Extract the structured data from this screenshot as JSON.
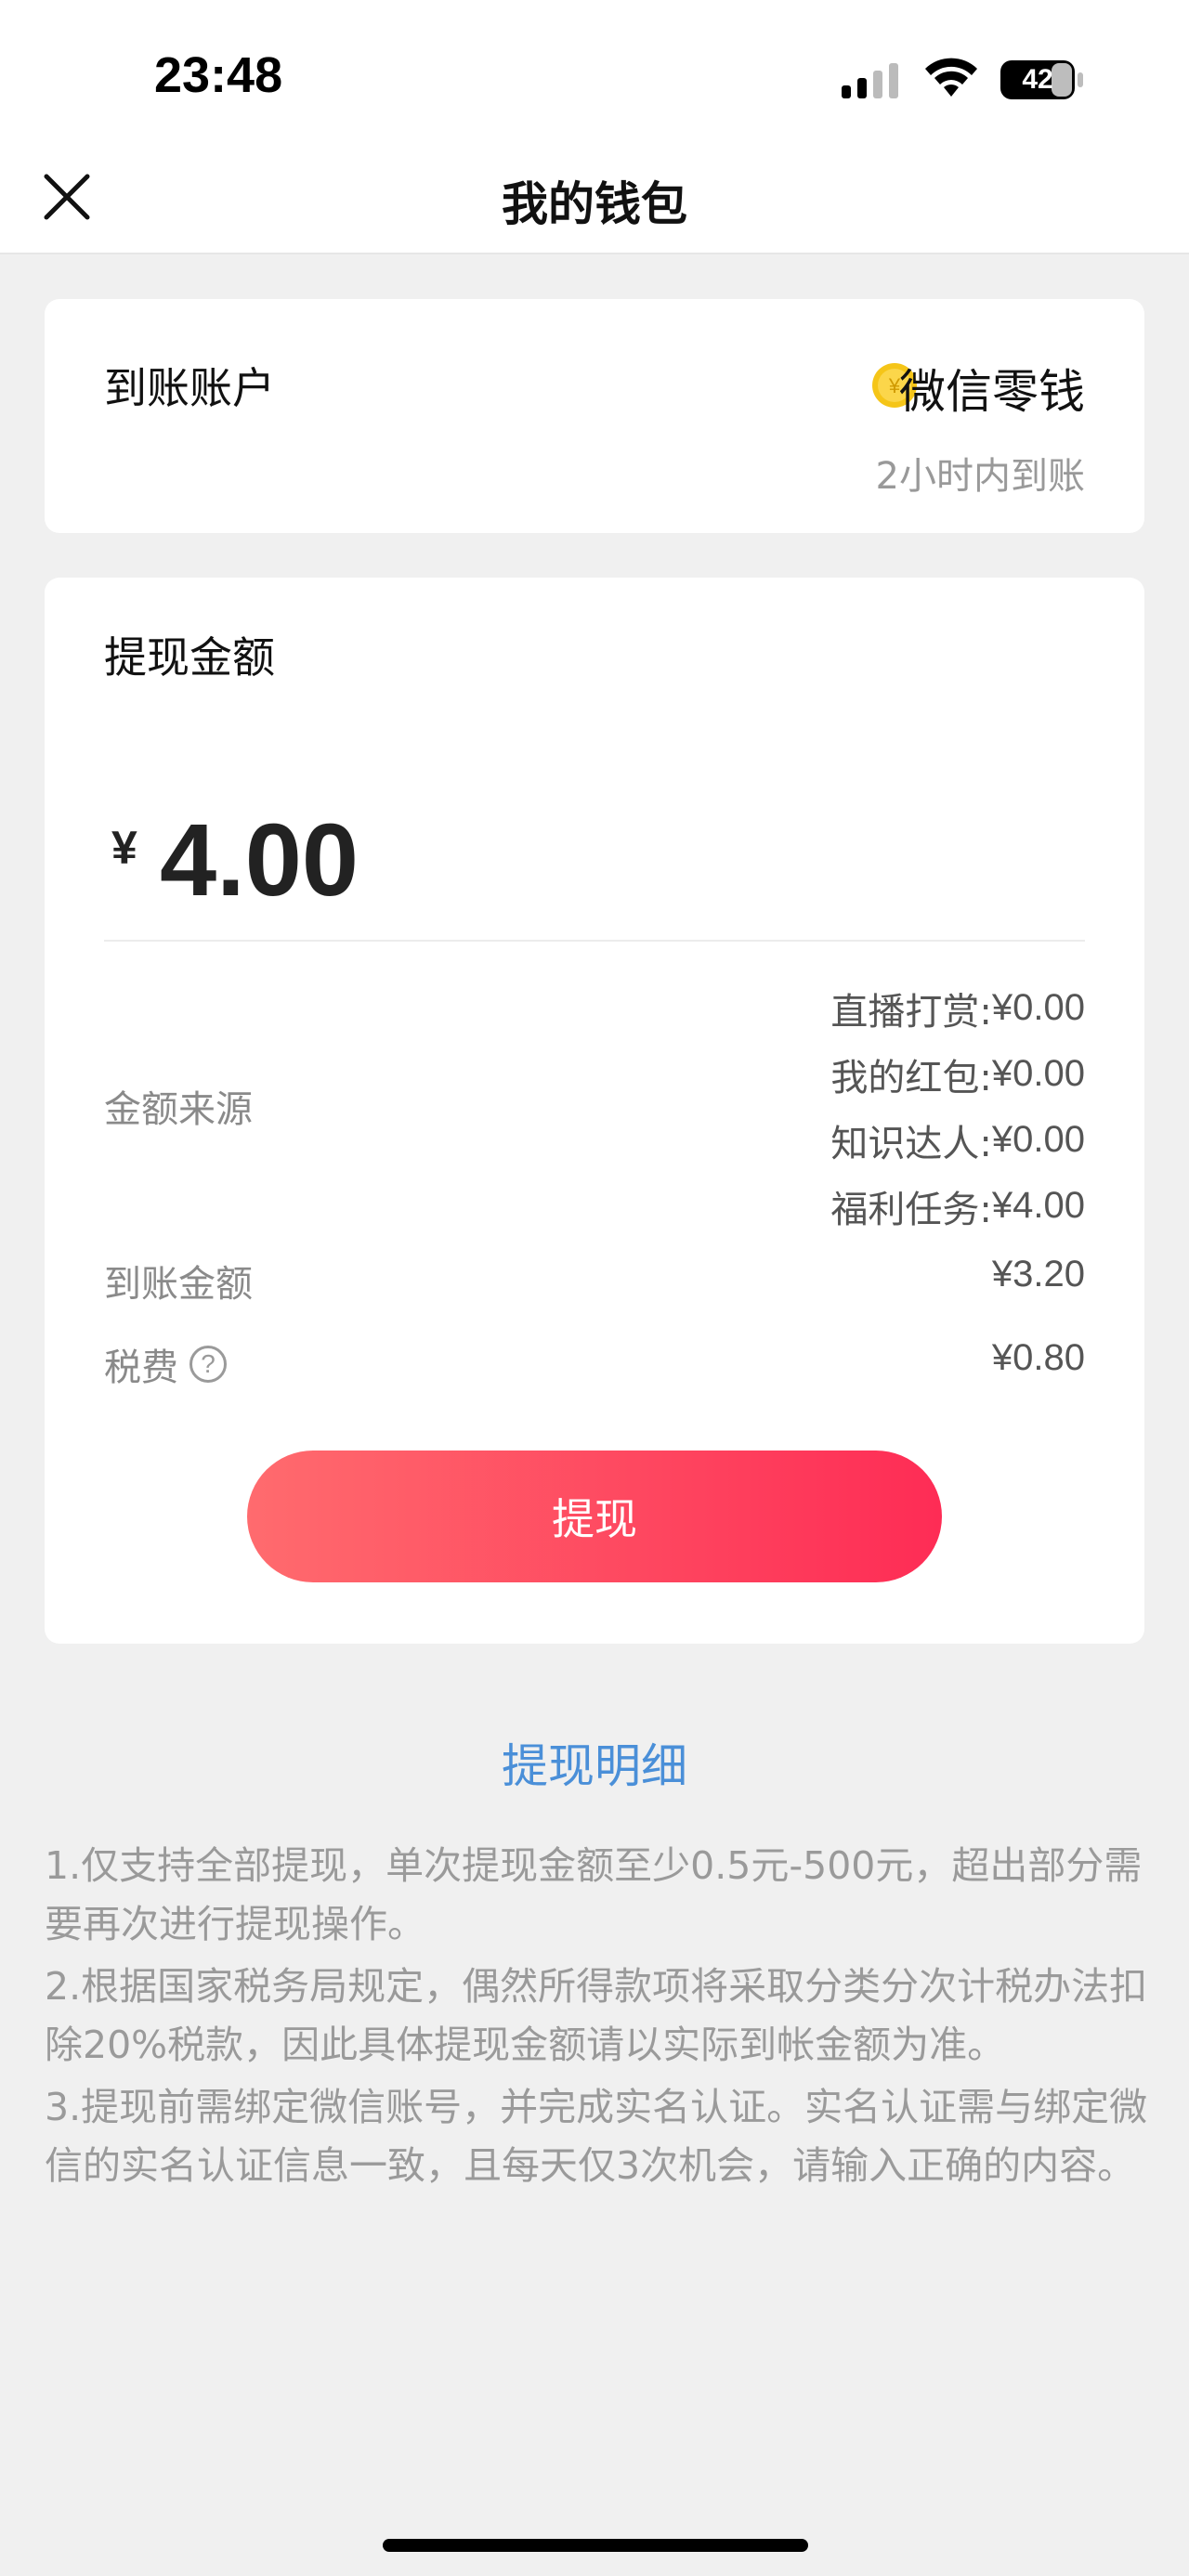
{
  "status_bar": {
    "time": "23:48",
    "battery": "42"
  },
  "nav": {
    "title": "我的钱包",
    "close_icon": "close-icon"
  },
  "account": {
    "label": "到账账户",
    "method": "微信零钱",
    "method_icon": "coin-icon",
    "note": "2小时内到账"
  },
  "withdraw": {
    "label": "提现金额",
    "currency": "¥",
    "amount": "4.00",
    "source_label": "金额来源",
    "sources": [
      {
        "name": "直播打赏:",
        "value": "¥0.00"
      },
      {
        "name": "我的红包:",
        "value": "¥0.00"
      },
      {
        "name": "知识达人:",
        "value": "¥0.00"
      },
      {
        "name": "福利任务:",
        "value": "¥4.00"
      }
    ],
    "received_label": "到账金额",
    "received_value": "¥3.20",
    "tax_label": "税费",
    "tax_value": "¥0.80",
    "button": "提现"
  },
  "details_link": "提现明细",
  "notes": [
    "1.仅支持全部提现，单次提现金额至少0.5元-500元，超出部分需要再次进行提现操作。",
    "2.根据国家税务局规定，偶然所得款项将采取分类分次计税办法扣除20%税款，因此具体提现金额请以实际到帐金额为准。",
    "3.提现前需绑定微信账号，并完成实名认证。实名认证需与绑定微信的实名认证信息一致，且每天仅3次机会，请输入正确的内容。"
  ],
  "colors": {
    "accent_start": "#ff6b6e",
    "accent_end": "#fe2c55",
    "link": "#4a8fd8",
    "coin": "#f5c518"
  }
}
